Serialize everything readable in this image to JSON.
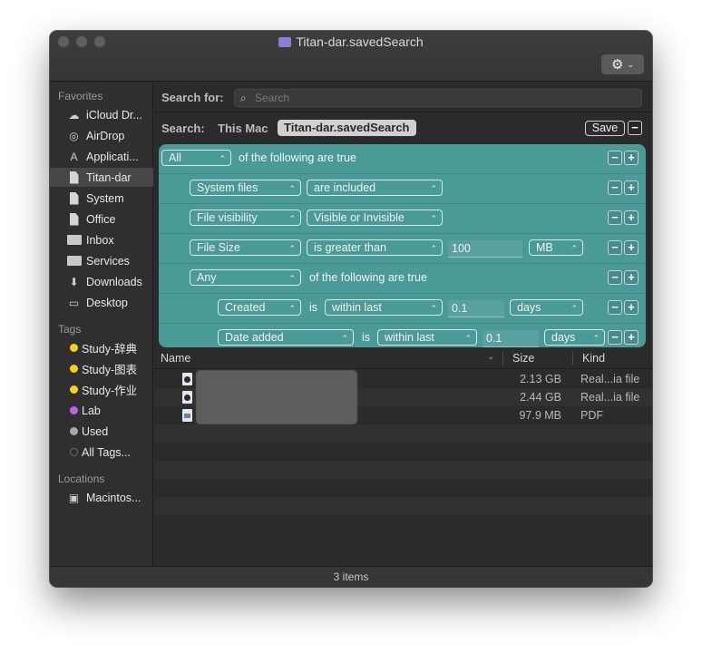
{
  "window": {
    "title": "Titan-dar.savedSearch",
    "status": "3 items"
  },
  "sidebar": {
    "favorites_header": "Favorites",
    "favorites": [
      {
        "label": "iCloud Dr...",
        "icon": "cloud-icon"
      },
      {
        "label": "AirDrop",
        "icon": "airdrop-icon"
      },
      {
        "label": "Applicati...",
        "icon": "applications-icon"
      },
      {
        "label": "Titan-dar",
        "icon": "document-icon",
        "selected": true
      },
      {
        "label": "System",
        "icon": "document-icon"
      },
      {
        "label": "Office",
        "icon": "document-icon"
      },
      {
        "label": "Inbox",
        "icon": "folder-icon"
      },
      {
        "label": "Services",
        "icon": "folder-icon"
      },
      {
        "label": "Downloads",
        "icon": "download-icon"
      },
      {
        "label": "Desktop",
        "icon": "desktop-icon"
      }
    ],
    "tags_header": "Tags",
    "tags": [
      {
        "label": "Study-辞典",
        "color": "#f5d21e"
      },
      {
        "label": "Study-图表",
        "color": "#f5d21e"
      },
      {
        "label": "Study-作业",
        "color": "#f5d21e"
      },
      {
        "label": "Lab",
        "color": "#c561e0"
      },
      {
        "label": "Used",
        "color": "#a8a8a8"
      },
      {
        "label": "All Tags...",
        "color": "#6a6a6a"
      }
    ],
    "locations_header": "Locations",
    "locations": [
      {
        "label": "Macintos...",
        "icon": "disk-icon"
      }
    ]
  },
  "search": {
    "label": "Search for:",
    "placeholder": "Search",
    "scope_label": "Search:",
    "scope_this_mac": "This Mac",
    "scope_selected": "Titan-dar.savedSearch",
    "save_label": "Save",
    "minus": "−",
    "plus": "+"
  },
  "criteria": {
    "row0": {
      "popup": "All",
      "text": "of the following are true"
    },
    "row1": {
      "attr": "System files",
      "op": "are included"
    },
    "row2": {
      "attr": "File visibility",
      "op": "Visible or Invisible"
    },
    "row3": {
      "attr": "File Size",
      "op": "is greater than",
      "value": "100",
      "unit": "MB"
    },
    "row4": {
      "popup": "Any",
      "text": "of the following are true"
    },
    "row5": {
      "attr": "Created",
      "is": "is",
      "op": "within last",
      "value": "0.1",
      "unit": "days"
    },
    "row6": {
      "attr": "Date added",
      "is": "is",
      "op": "within last",
      "value": "0.1",
      "unit": "days"
    }
  },
  "results": {
    "columns": {
      "name": "Name",
      "size": "Size",
      "kind": "Kind"
    },
    "rows": [
      {
        "size": "2.13 GB",
        "kind": "Real...ia file"
      },
      {
        "size": "2.44 GB",
        "kind": "Real...ia file"
      },
      {
        "size": "97.9 MB",
        "kind": "PDF"
      }
    ]
  }
}
